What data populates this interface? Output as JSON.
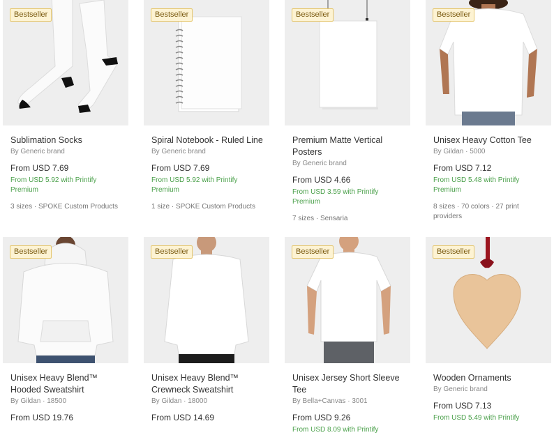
{
  "products": [
    {
      "badge": "Bestseller",
      "title": "Sublimation Socks",
      "brand": "By Generic brand",
      "price": "From USD 7.69",
      "premium": "From USD 5.92 with Printify Premium",
      "meta": "3 sizes · SPOKE Custom Products"
    },
    {
      "badge": "Bestseller",
      "title": "Spiral Notebook - Ruled Line",
      "brand": "By Generic brand",
      "price": "From USD 7.69",
      "premium": "From USD 5.92 with Printify Premium",
      "meta": "1 size · SPOKE Custom Products"
    },
    {
      "badge": "Bestseller",
      "title": "Premium Matte Vertical Posters",
      "brand": "By Generic brand",
      "price": "From USD 4.66",
      "premium": "From USD 3.59 with Printify Premium",
      "meta": "7 sizes · Sensaria"
    },
    {
      "badge": "Bestseller",
      "title": "Unisex Heavy Cotton Tee",
      "brand": "By Gildan · 5000",
      "price": "From USD 7.12",
      "premium": "From USD 5.48 with Printify Premium",
      "meta": "8 sizes · 70 colors · 27 print providers"
    },
    {
      "badge": "Bestseller",
      "title": "Unisex Heavy Blend™ Hooded Sweatshirt",
      "brand": "By Gildan · 18500",
      "price": "From USD 19.76",
      "premium": "",
      "meta": ""
    },
    {
      "badge": "Bestseller",
      "title": "Unisex Heavy Blend™ Crewneck Sweatshirt",
      "brand": "By Gildan · 18000",
      "price": "From USD 14.69",
      "premium": "",
      "meta": ""
    },
    {
      "badge": "Bestseller",
      "title": "Unisex Jersey Short Sleeve Tee",
      "brand": "By Bella+Canvas · 3001",
      "price": "From USD 9.26",
      "premium": "From USD 8.09 with Printify",
      "meta": ""
    },
    {
      "badge": "Bestseller",
      "title": "Wooden Ornaments",
      "brand": "By Generic brand",
      "price": "From USD 7.13",
      "premium": "From USD 5.49 with Printify",
      "meta": ""
    }
  ]
}
